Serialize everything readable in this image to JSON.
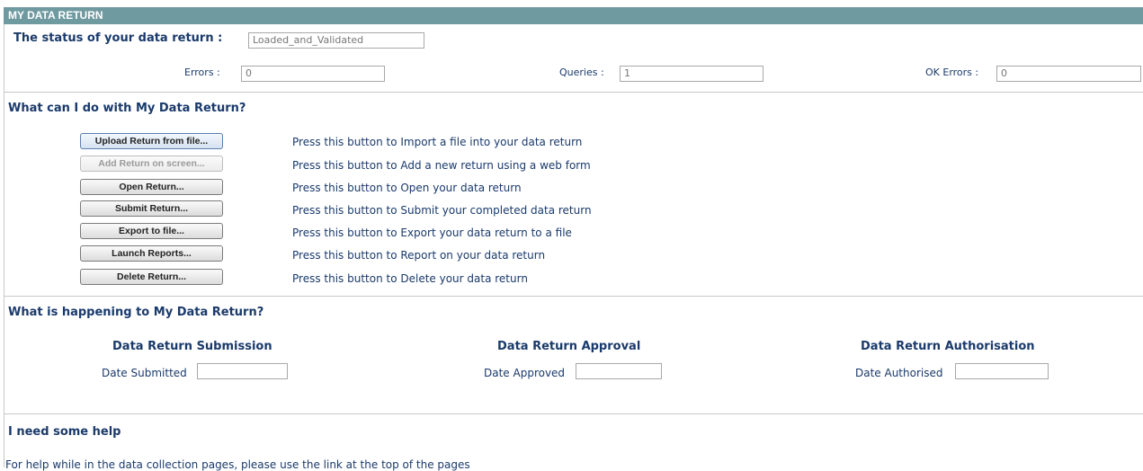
{
  "header": {
    "title": "MY DATA RETURN"
  },
  "status": {
    "label": "The status of your data return :",
    "value": "Loaded_and_Validated",
    "errors_label": "Errors :",
    "errors_value": "0",
    "queries_label": "Queries :",
    "queries_value": "1",
    "ok_errors_label": "OK Errors :",
    "ok_errors_value": "0"
  },
  "actions": {
    "title": "What can I do with My Data Return?",
    "buttons": [
      {
        "label": "Upload Return from file...",
        "desc": "Press this button to Import a file into your data return"
      },
      {
        "label": "Add Return on screen...",
        "desc": "Press this button to Add a new return using a web form"
      },
      {
        "label": "Open Return...",
        "desc": "Press this button to Open your data return"
      },
      {
        "label": "Submit Return...",
        "desc": "Press this button to Submit your completed data return"
      },
      {
        "label": "Export to file...",
        "desc": "Press this button to Export your data return to a file"
      },
      {
        "label": "Launch Reports...",
        "desc": "Press this button to Report on your data return"
      },
      {
        "label": "Delete Return...",
        "desc": "Press this button to Delete your data return"
      }
    ]
  },
  "progress": {
    "title": "What is happening to My Data Return?",
    "submission": {
      "title": "Data Return Submission",
      "label": "Date Submitted",
      "value": ""
    },
    "approval": {
      "title": "Data Return Approval",
      "label": "Date Approved",
      "value": ""
    },
    "authorisation": {
      "title": "Data Return Authorisation",
      "label": "Date Authorised",
      "value": ""
    }
  },
  "help": {
    "title": "I need some help",
    "text": "For help while in the data collection pages, please use the link at the top of the pages"
  }
}
